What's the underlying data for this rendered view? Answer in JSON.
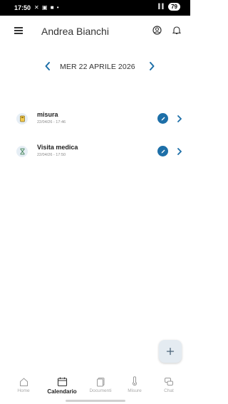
{
  "status_bar": {
    "time": "17:50",
    "icons": "✕ ▣ ■ •",
    "signal": "▌▌",
    "battery": "79"
  },
  "header": {
    "title": "Andrea Bianchi"
  },
  "date_nav": {
    "date": "MER 22 APRILE 2026"
  },
  "events": [
    {
      "title": "misura",
      "subtitle": "22/04/26 - 17:46",
      "icon": "measure-icon"
    },
    {
      "title": "Visita medica",
      "subtitle": "22/04/26 - 17:50",
      "icon": "hourglass-icon"
    }
  ],
  "nav": [
    {
      "label": "Home",
      "icon": "home-icon"
    },
    {
      "label": "Calendario",
      "icon": "calendar-icon",
      "active": true
    },
    {
      "label": "Documenti",
      "icon": "documents-icon"
    },
    {
      "label": "Misure",
      "icon": "thermometer-icon"
    },
    {
      "label": "Chat",
      "icon": "chat-icon"
    }
  ],
  "colors": {
    "accent": "#1d6fa8",
    "fab_bg": "#e4ebf1"
  }
}
